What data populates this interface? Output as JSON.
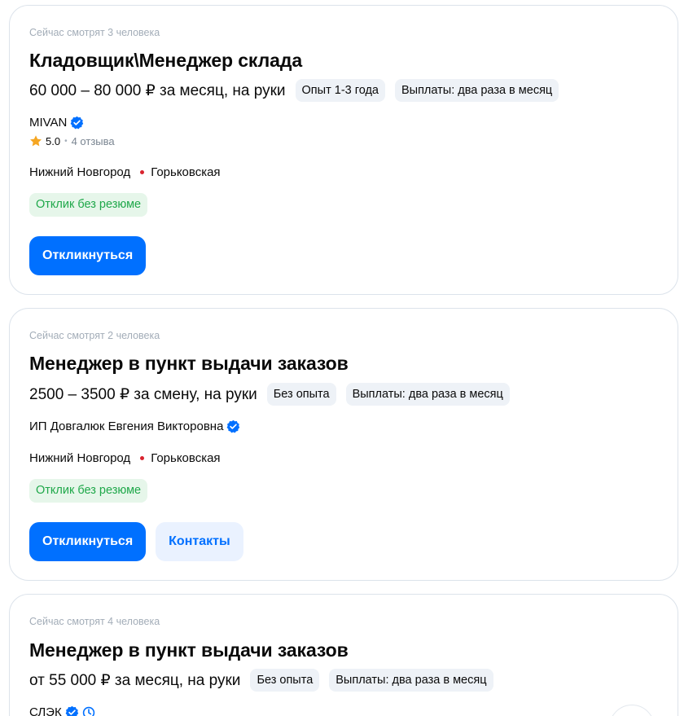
{
  "vacancies": [
    {
      "viewers": "Сейчас смотрят 3 человека",
      "title": "Кладовщик\\Менеджер склада",
      "salary": "60 000 – 80 000 ₽ за месяц, на руки",
      "tags": [
        "Опыт 1-3 года",
        "Выплаты: два раза в месяц"
      ],
      "company": "MIVAN",
      "rating": "5.0",
      "reviews": "4 отзыва",
      "city": "Нижний Новгород",
      "metro": "Горьковская",
      "badge": "Отклик без резюме",
      "respond_label": "Откликнуться"
    },
    {
      "viewers": "Сейчас смотрят 2 человека",
      "title": "Менеджер в пункт выдачи заказов",
      "salary": "2500 – 3500 ₽ за смену, на руки",
      "tags": [
        "Без опыта",
        "Выплаты: два раза в месяц"
      ],
      "company": "ИП Довгалюк Евгения Викторовна",
      "city": "Нижний Новгород",
      "metro": "Горьковская",
      "badge": "Отклик без резюме",
      "respond_label": "Откликнуться",
      "contacts_label": "Контакты"
    },
    {
      "viewers": "Сейчас смотрят 4 человека",
      "title": "Менеджер в пункт выдачи заказов",
      "salary": "от 55 000 ₽ за месяц, на руки",
      "tags": [
        "Без опыта",
        "Выплаты: два раза в месяц"
      ],
      "company": "СЛЭК"
    }
  ],
  "colors": {
    "accent": "#0070ff",
    "badge_bg": "#e6f6ea",
    "badge_text": "#1fa84a",
    "metro": "#d9232e",
    "star": "#f5a623"
  },
  "icons": {
    "verified": "verified-check-icon",
    "star": "star-icon",
    "metro": "metro-dot-icon",
    "trusted": "trusted-employer-icon"
  }
}
